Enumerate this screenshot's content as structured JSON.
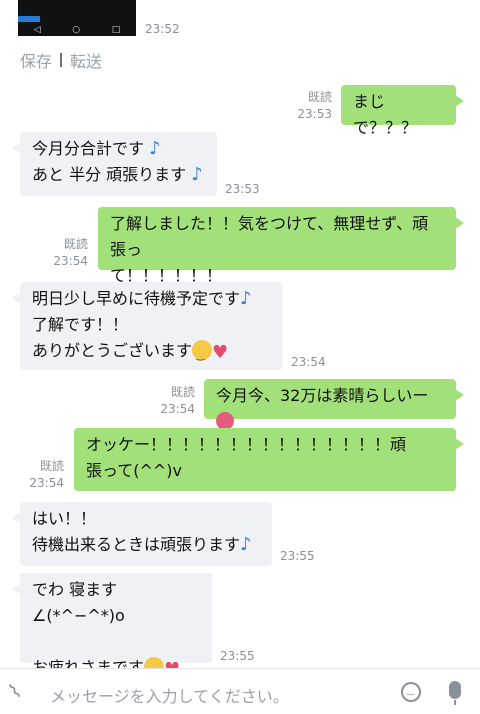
{
  "top": {
    "time": "23:52",
    "nav": [
      "◁",
      "○",
      "□"
    ]
  },
  "menu": {
    "save": "保存",
    "forward": "転送"
  },
  "messages": [
    {
      "side": "right",
      "lines": [
        "まじで？？？"
      ],
      "read": "既読",
      "time": "23:53"
    },
    {
      "side": "left",
      "lines": [
        "今月分合計です",
        "あと 半分 頑張ります"
      ],
      "time": "23:53"
    },
    {
      "side": "right",
      "lines": [
        "了解しました！！気をつけて、無理せず、頑張っ",
        "て！！！！！！"
      ],
      "read": "既読",
      "time": "23:54"
    },
    {
      "side": "left",
      "lines": [
        "明日少し早めに待機予定です",
        "了解です！！",
        "ありがとうございます"
      ],
      "time": "23:54"
    },
    {
      "side": "right",
      "lines": [
        "今月今、32万は素晴らしいー"
      ],
      "read": "既読",
      "time": "23:54"
    },
    {
      "side": "right",
      "lines": [
        "オッケー！！！！！！！！！！！！！！！頑",
        "張って(^^)v"
      ],
      "read": "既読",
      "time": "23:54"
    },
    {
      "side": "left",
      "lines": [
        "はい！！",
        "待機出来るときは頑張ります"
      ],
      "time": "23:55"
    },
    {
      "side": "left",
      "lines": [
        "でわ 寝ます∠(*^−^*)o",
        "",
        "お疲れさまです"
      ],
      "time": "23:55"
    }
  ],
  "input": {
    "placeholder": "メッセージを入力してください。"
  },
  "icons": {
    "attach": "paperclip-icon",
    "emoji": "smiley-icon",
    "voice": "mic-icon",
    "note": "music-note-icon",
    "face": "smiling-face-icon",
    "heart": "heart-icon",
    "flower": "hibiscus-icon"
  },
  "colors": {
    "sent_bubble": "#a2e07a",
    "received_bubble": "#eff1f4",
    "meta_text": "#8a8f99"
  }
}
